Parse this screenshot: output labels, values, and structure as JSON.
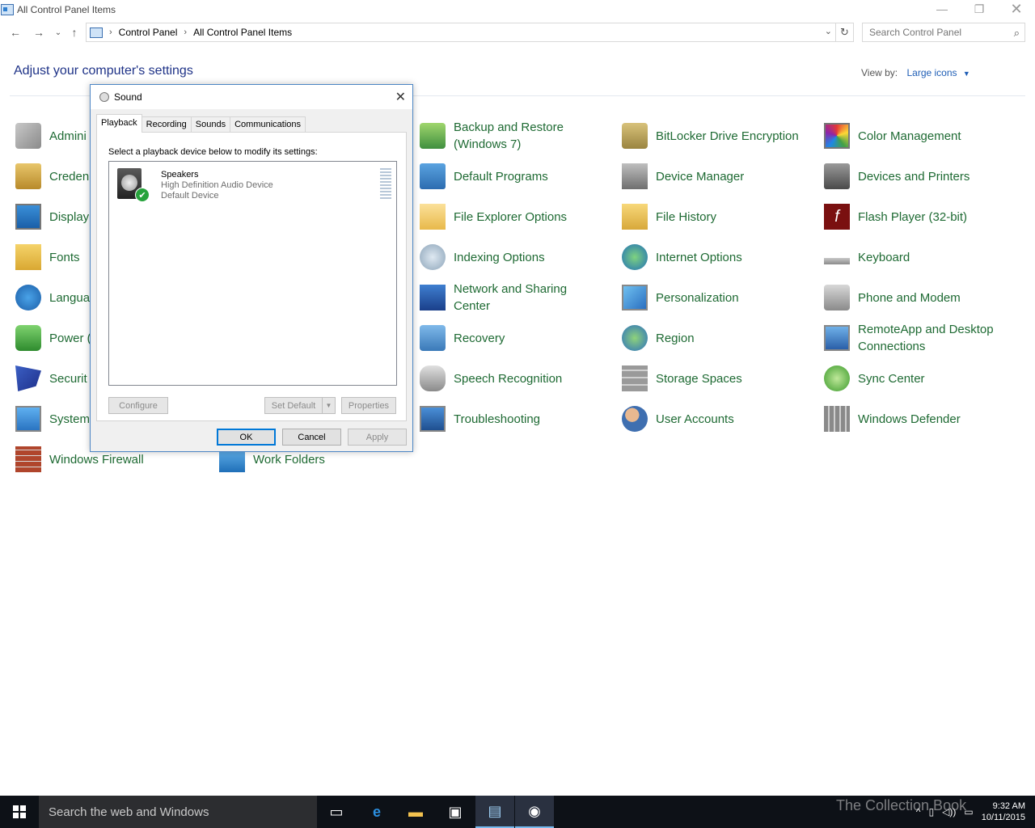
{
  "window": {
    "title": "All Control Panel Items"
  },
  "address": {
    "crumbs": [
      "Control Panel",
      "All Control Panel Items"
    ]
  },
  "search": {
    "placeholder": "Search Control Panel"
  },
  "header": {
    "title": "Adjust your computer's settings",
    "view_by_label": "View by:",
    "view_by_value": "Large icons"
  },
  "items": [
    {
      "label": "Admini",
      "icon": "administrative-tools-icon"
    },
    {
      "label": "Creden",
      "icon": "credential-manager-icon"
    },
    {
      "label": "Display",
      "icon": "display-icon"
    },
    {
      "label": "Fonts",
      "icon": "fonts-icon"
    },
    {
      "label": "Langua",
      "icon": "language-icon"
    },
    {
      "label": "Power (",
      "icon": "power-options-icon"
    },
    {
      "label": "Securit",
      "icon": "security-icon"
    },
    {
      "label": "System",
      "icon": "system-icon"
    },
    {
      "label": "Windows Firewall",
      "icon": "windows-firewall-icon"
    },
    {
      "label": "Work Folders",
      "icon": "work-folders-icon"
    },
    {
      "label": "Backup and Restore\n(Windows 7)",
      "icon": "backup-restore-icon"
    },
    {
      "label": "Default Programs",
      "icon": "default-programs-icon"
    },
    {
      "label": "File Explorer Options",
      "icon": "file-explorer-options-icon"
    },
    {
      "label": "Indexing Options",
      "icon": "indexing-options-icon"
    },
    {
      "label": "Network and Sharing\nCenter",
      "icon": "network-sharing-icon"
    },
    {
      "label": "Recovery",
      "icon": "recovery-icon"
    },
    {
      "label": "Speech Recognition",
      "icon": "microphone-icon"
    },
    {
      "label": "Troubleshooting",
      "icon": "troubleshooting-icon"
    },
    {
      "label": "BitLocker Drive Encryption",
      "icon": "bitlocker-icon"
    },
    {
      "label": "Device Manager",
      "icon": "device-manager-icon"
    },
    {
      "label": "File History",
      "icon": "file-history-icon"
    },
    {
      "label": "Internet Options",
      "icon": "internet-options-icon"
    },
    {
      "label": "Personalization",
      "icon": "personalization-icon"
    },
    {
      "label": "Region",
      "icon": "region-icon"
    },
    {
      "label": "Storage Spaces",
      "icon": "storage-spaces-icon"
    },
    {
      "label": "User Accounts",
      "icon": "user-accounts-icon"
    },
    {
      "label": "Color Management",
      "icon": "color-management-icon"
    },
    {
      "label": "Devices and Printers",
      "icon": "devices-printers-icon"
    },
    {
      "label": "Flash Player (32-bit)",
      "icon": "flash-player-icon"
    },
    {
      "label": "Keyboard",
      "icon": "keyboard-icon"
    },
    {
      "label": "Phone and Modem",
      "icon": "phone-modem-icon"
    },
    {
      "label": "RemoteApp and Desktop\nConnections",
      "icon": "remoteapp-icon"
    },
    {
      "label": "Sync Center",
      "icon": "sync-center-icon"
    },
    {
      "label": "Windows Defender",
      "icon": "windows-defender-icon"
    }
  ],
  "dialog": {
    "title": "Sound",
    "tabs": [
      "Playback",
      "Recording",
      "Sounds",
      "Communications"
    ],
    "instruction": "Select a playback device below to modify its settings:",
    "device": {
      "name": "Speakers",
      "driver": "High Definition Audio Device",
      "status": "Default Device"
    },
    "buttons": {
      "configure": "Configure",
      "set_default": "Set Default",
      "properties": "Properties",
      "ok": "OK",
      "cancel": "Cancel",
      "apply": "Apply"
    }
  },
  "taskbar": {
    "search_placeholder": "Search the web and Windows",
    "time": "9:32 AM",
    "date": "10/11/2015",
    "watermark": "The Collection Book"
  }
}
